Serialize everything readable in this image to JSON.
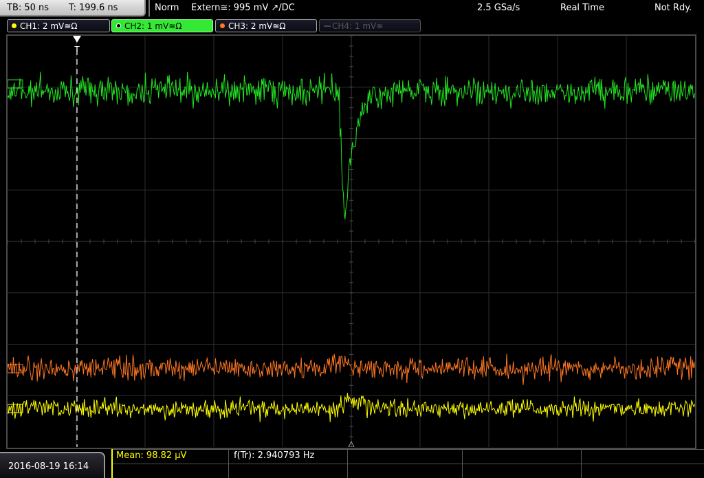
{
  "topbar": {
    "timebase": "TB: 50 ns",
    "trigger_time": "T: 199.6 ns",
    "mode": "Norm",
    "trigger_source": "Extern≅: 995 mV ↗/DC",
    "sample_rate": "2.5 GSa/s",
    "acquisition": "Real Time",
    "status": "Not Rdy."
  },
  "channels": [
    {
      "label": "CH1: 2 mV≅Ω",
      "color": "#ffff00",
      "active": false,
      "enabled": true
    },
    {
      "label": "CH2: 1 mV≅Ω",
      "color": "#36e836",
      "active": true,
      "enabled": true
    },
    {
      "label": "CH3: 2 mV≅Ω",
      "color": "#ff7a1a",
      "active": false,
      "enabled": true
    },
    {
      "label": "CH4: 1 mV≅",
      "color": "#555555",
      "active": false,
      "enabled": false
    }
  ],
  "trigger_marker": "T",
  "traces": {
    "ch2_color": "#22e622",
    "ch3_color": "#ff7722",
    "ch1_color": "#ffff00"
  },
  "footer": {
    "datetime": "2016-08-19 16:14",
    "mean": "Mean: 98.82 µV",
    "frequency": "f(Tr): 2.940793 Hz"
  }
}
